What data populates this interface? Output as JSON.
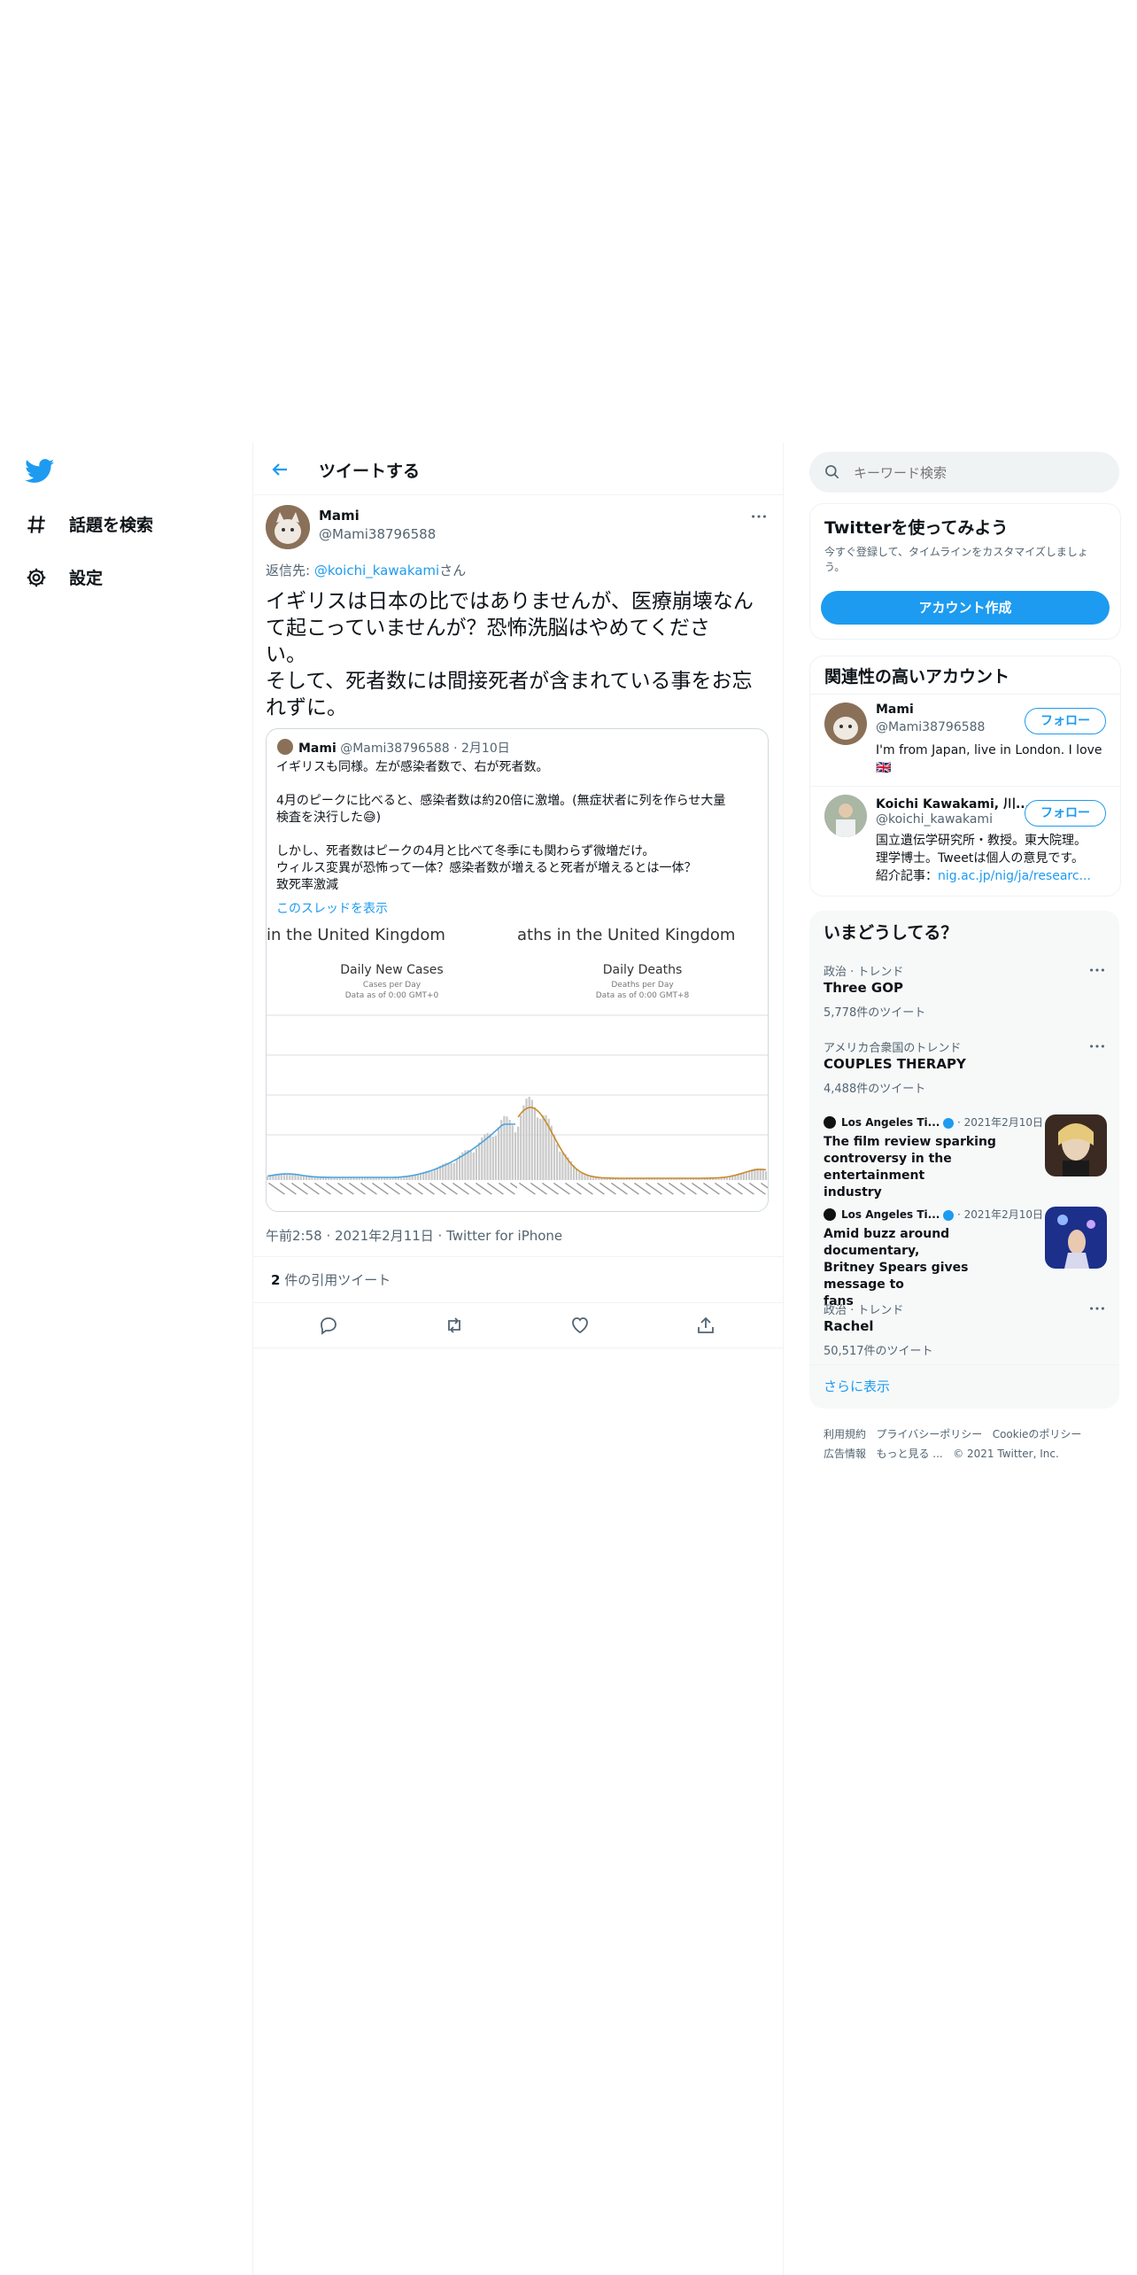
{
  "nav": {
    "explore_label": "話題を検索",
    "settings_label": "設定"
  },
  "header": {
    "title": "ツイートする"
  },
  "tweet": {
    "author_name": "Mami",
    "author_handle": "@Mami38796588",
    "reply_prefix": "返信先: ",
    "reply_to": "@koichi_kawakami",
    "reply_suffix": "さん",
    "text_lines": [
      "イギリスは日本の比ではありませんが、医療崩壊なん",
      "て起こっていませんが？恐怖洗脳はやめてくださ",
      "い。",
      "そして、死者数には間接死者が含まれている事をお忘",
      "れずに。"
    ],
    "quote": {
      "author_name": "Mami",
      "author_handle": "@Mami38796588",
      "date": "· 2月10日",
      "lines": [
        "イギリスも同様。左が感染者数で、右が死者数。",
        "",
        "4月のピークに比べると、感染者数は約20倍に激増。(無症状者に列を作らせ大量",
        "検査を決行した😅)",
        "",
        "しかし、死者数はピークの4月と比べて冬季にも関わらず微増だけ。",
        "ウィルス変異が恐怖って一体？感染者数が増えると死者が増えるとは一体？",
        "致死率激減"
      ],
      "thread_link": "このスレッドを表示",
      "left_chart": {
        "header": "in the United Kingdom",
        "title": "Daily New Cases",
        "sub1": "Cases per Day",
        "sub2": "Data as of 0:00 GMT+0"
      },
      "right_chart": {
        "header": "aths in the United Kingdom",
        "title": "Daily Deaths",
        "sub1": "Deaths per Day",
        "sub2": "Data as of 0:00 GMT+8"
      }
    },
    "timestamp": "午前2:58 · 2021年2月11日 · Twitter for iPhone",
    "quote_count": "2",
    "quote_count_label": " 件の引用ツイート"
  },
  "right": {
    "search_placeholder": "キーワード検索",
    "signup": {
      "title": "Twitterを使ってみよう",
      "desc_line1": "今すぐ登録して、タイムラインをカスタマイズしましょ",
      "desc_line2": "う。",
      "button": "アカウント作成"
    },
    "related": {
      "title": "関連性の高いアカウント",
      "accounts": [
        {
          "name": "Mami",
          "handle": "@Mami38796588",
          "bio_line1": "I'm from Japan, live in London. I love",
          "bio_line2": "🇬🇧",
          "follow": "フォロー"
        },
        {
          "name": "Koichi Kawakami, 川...",
          "handle": "@koichi_kawakami",
          "bio_line1": "国立遺伝学研究所・教授。東大院理。",
          "bio_line2": "理学博士。Tweetは個人の意見です。",
          "bio_line3_prefix": "紹介記事：",
          "bio_line3_link": "nig.ac.jp/nig/ja/researc...",
          "follow": "フォロー"
        }
      ]
    },
    "trends": {
      "title": "いまどうしてる？",
      "items": [
        {
          "meta": "政治 · トレンド",
          "name": "Three GOP",
          "count": "5,778件のツイート"
        },
        {
          "meta": "アメリカ合衆国のトレンド",
          "name": "COUPLES THERAPY",
          "count": "4,488件のツイート"
        },
        {
          "source": "Los Angeles Ti...",
          "date": "· 2021年2月10日",
          "headline_lines": [
            "The film review sparking",
            "controversy in the entertainment",
            "industry"
          ]
        },
        {
          "source": "Los Angeles Ti...",
          "date": "· 2021年2月10日",
          "headline_lines": [
            "Amid buzz around documentary,",
            "Britney Spears gives message to",
            "fans"
          ]
        },
        {
          "meta": "政治 · トレンド",
          "name": "Rachel",
          "count": "50,517件のツイート"
        }
      ],
      "show_more": "さらに表示"
    },
    "footer": {
      "row1": [
        "利用規約",
        "プライバシーポリシー",
        "Cookieのポリシー"
      ],
      "row2": [
        "広告情報",
        "もっと見る ...",
        "© 2021 Twitter, Inc."
      ]
    }
  },
  "colors": {
    "accent": "#1d9bf0",
    "text": "#0f1419",
    "muted": "#536471",
    "cases_line": "#4aa3df",
    "deaths_line": "#c98a2b"
  }
}
